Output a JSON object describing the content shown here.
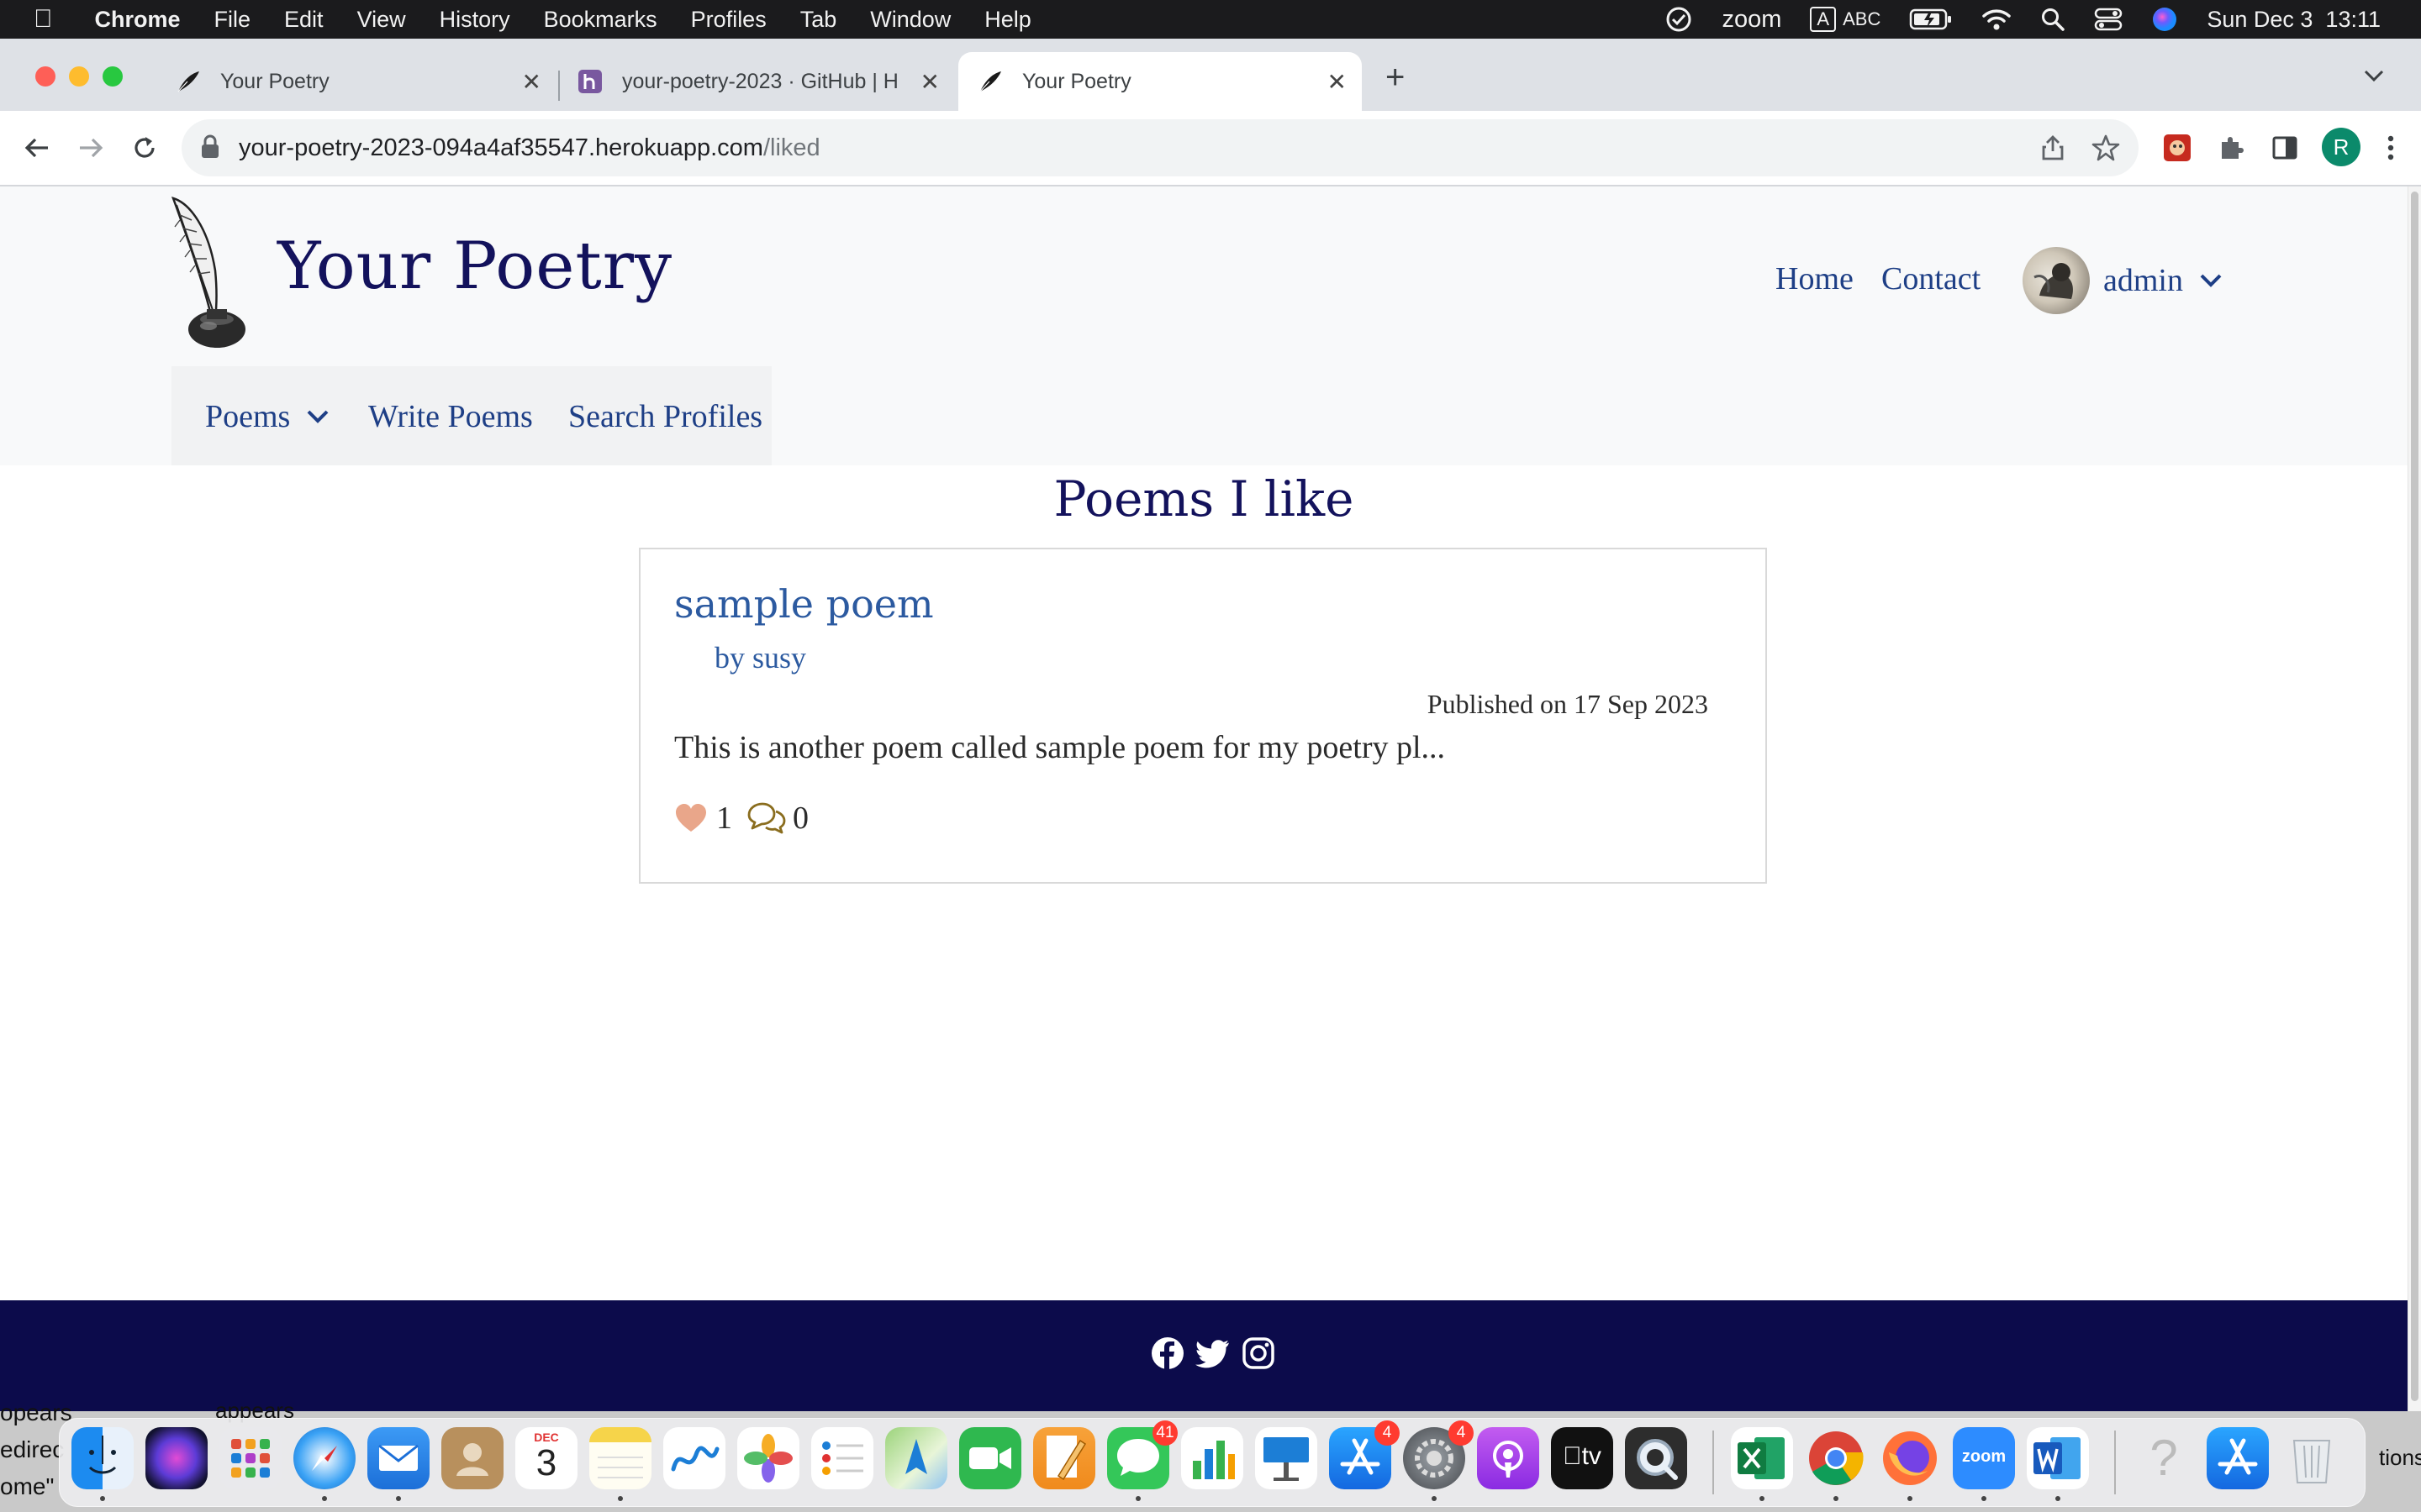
{
  "menubar": {
    "app_name": "Chrome",
    "items": [
      "File",
      "Edit",
      "View",
      "History",
      "Bookmarks",
      "Profiles",
      "Tab",
      "Window",
      "Help"
    ],
    "zoom_label": "zoom",
    "input_badge": "A",
    "input_source": "ABC",
    "datetime": "Sun Dec 3  13:11"
  },
  "browser": {
    "tabs": [
      {
        "title": "Your Poetry",
        "icon": "quill-icon",
        "active": false
      },
      {
        "title": "your-poetry-2023 · GitHub | H",
        "icon": "heroku-icon",
        "active": false
      },
      {
        "title": "Your Poetry",
        "icon": "quill-icon",
        "active": true
      }
    ],
    "url_host": "your-poetry-2023-094a4af35547.herokuapp.com",
    "url_path": "/liked",
    "profile_initial": "R"
  },
  "site": {
    "brand": "Your Poetry",
    "nav": {
      "home": "Home",
      "contact": "Contact",
      "user": "admin",
      "poems": "Poems",
      "write": "Write Poems",
      "search": "Search Profiles"
    },
    "page_title": "Poems I like",
    "poem": {
      "title": "sample poem",
      "author": "by susy",
      "published": "Published on 17 Sep 2023",
      "excerpt": "This is another poem called sample poem for my poetry pl...",
      "likes": "1",
      "comments": "0"
    },
    "footer_icons": [
      "facebook-icon",
      "twitter-icon",
      "instagram-icon"
    ]
  },
  "dock": {
    "calendar_month": "DEC",
    "calendar_day": "3",
    "messages_badge": "41",
    "appstore_badge": "4",
    "settings_badge": "4",
    "tv_label": "tv",
    "zoom_label": "zoom"
  },
  "background_window": {
    "left_fragments": [
      "opears",
      "edirec",
      "ome\""
    ],
    "fragment_appears": "appears",
    "fragment_right": "tions"
  },
  "colors": {
    "brand_navy": "#13125c",
    "link_blue": "#1e3f86",
    "footer_navy": "#0c0b4b",
    "heart": "#e9a68a",
    "comment": "#8a6d1e"
  }
}
